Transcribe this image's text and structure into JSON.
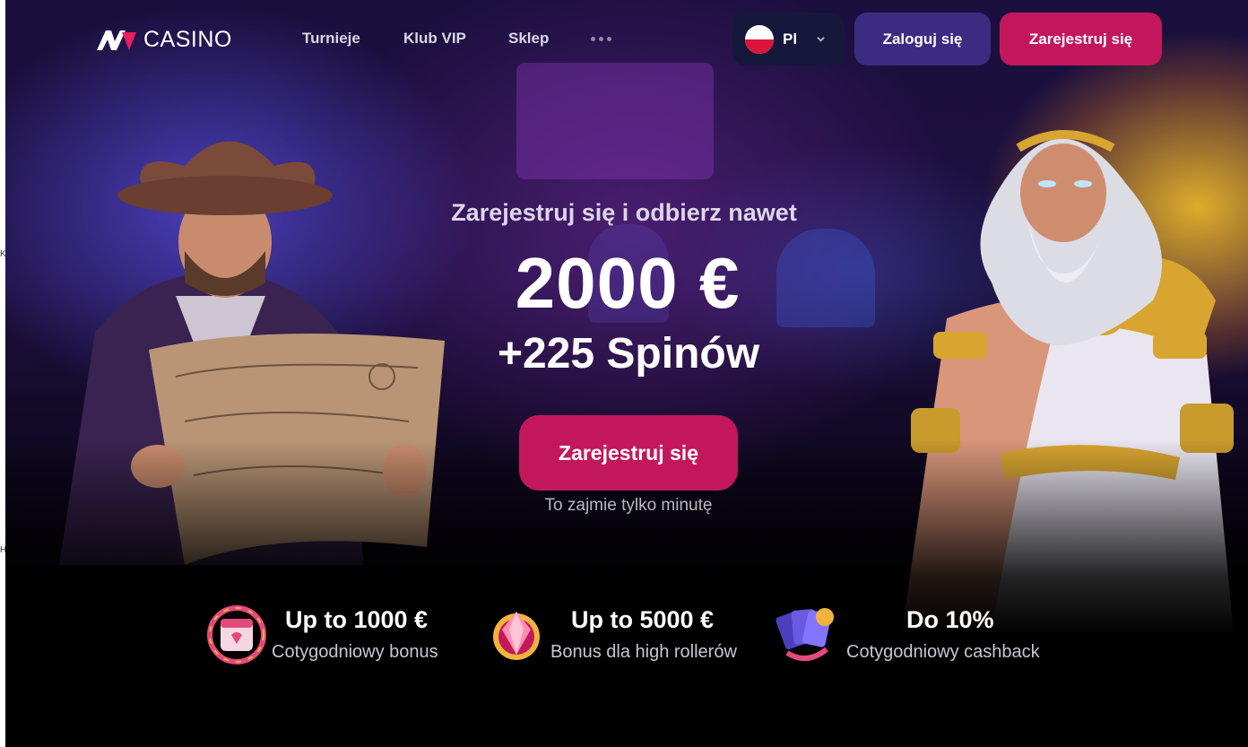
{
  "header": {
    "logo_text": "CASINO",
    "nav": [
      "Turnieje",
      "Klub VIP",
      "Sklep"
    ],
    "more_icon": "more-dots-icon",
    "language": {
      "code": "Pl",
      "flag": "poland-flag-icon"
    },
    "login_label": "Zaloguj się",
    "register_label": "Zarejestruj się"
  },
  "hero": {
    "subtitle": "Zarejestruj się i odbierz nawet",
    "amount": "2000 €",
    "spins": "+225 Spinów",
    "cta_label": "Zarejestruj się",
    "cta_note": "To zajmie tylko minutę"
  },
  "features": [
    {
      "icon": "calendar-bonus-icon",
      "title": "Up to 1000 €",
      "description": "Cotygodniowy bonus"
    },
    {
      "icon": "gem-highroller-icon",
      "title": "Up to 5000 €",
      "description": "Bonus dla high rollerów"
    },
    {
      "icon": "cards-cashback-icon",
      "title": "Do 10%",
      "description": "Cotygodniowy cashback"
    }
  ],
  "edge_glyphs": [
    "K",
    "H"
  ],
  "colors": {
    "accent": "#c2185b",
    "login_button": "#3b2c82",
    "language_bg": "#15183a",
    "background": "#000000"
  }
}
